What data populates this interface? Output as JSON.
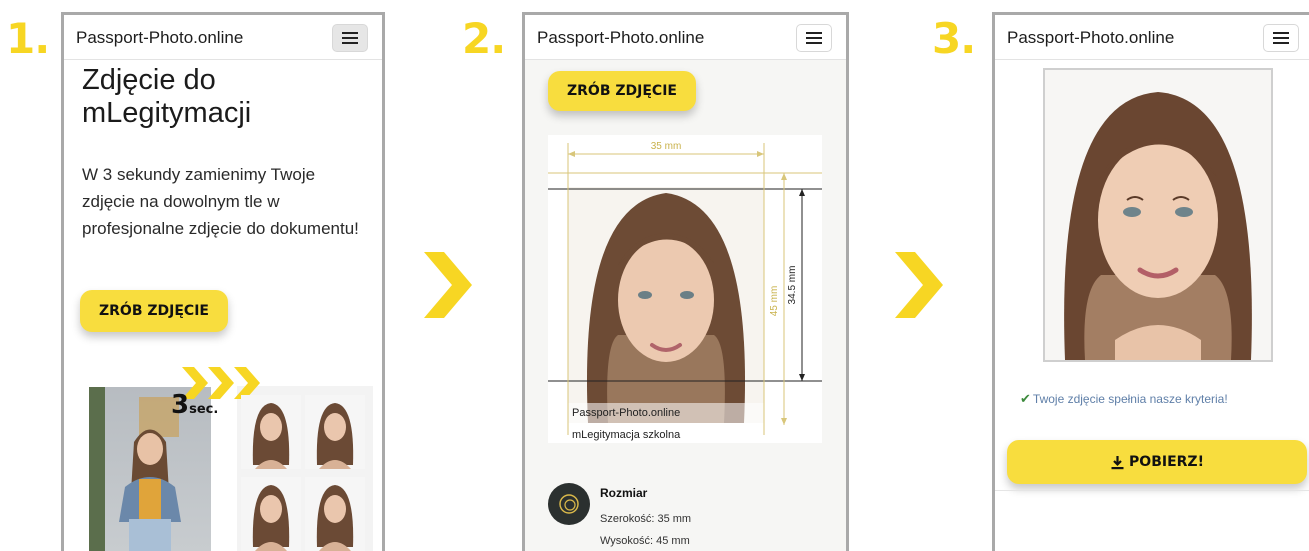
{
  "steps": [
    {
      "number": "1."
    },
    {
      "number": "2."
    },
    {
      "number": "3."
    }
  ],
  "brand": "Passport-Photo.online",
  "screen1": {
    "headline": "Zdjęcie do mLegitymacji",
    "lead": "W 3 sekundy zamienimy Twoje zdjęcie na dowolnym tle w profesjonalne zdjęcie do dokumentu!",
    "cta": "ZRÓB ZDJĘCIE",
    "promo_number": "3",
    "promo_unit": "sec."
  },
  "screen2": {
    "cta": "ZRÓB ZDJĘCIE",
    "width_label": "35 mm",
    "height_label": "45 mm",
    "face_label": "34.5 mm",
    "caption_brand": "Passport-Photo.online",
    "caption_doc": "mLegitymacja szkolna",
    "size_title": "Rozmiar",
    "width_line": "Szerokość: 35 mm",
    "height_line": "Wysokość: 45 mm"
  },
  "screen3": {
    "ok_message": "Twoje zdjęcie spełnia nasze kryteria!",
    "download": "POBIERZ!"
  },
  "colors": {
    "accent": "#f8dd3e",
    "step": "#f7d623",
    "ok": "#3c8a3c",
    "ok_text": "#5f7fa8"
  },
  "icons": {
    "menu": "hamburger-icon",
    "arrow": "chevron-right-icon",
    "check": "check-icon",
    "download": "download-icon",
    "size": "size-icon"
  }
}
